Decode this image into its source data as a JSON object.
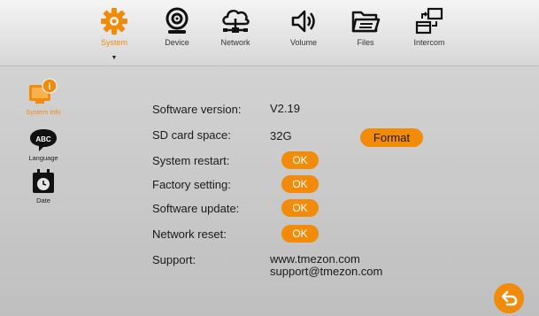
{
  "tabs": [
    {
      "label": "System",
      "icon": "gear-icon",
      "active": true
    },
    {
      "label": "Device",
      "icon": "webcam-icon"
    },
    {
      "label": "Network",
      "icon": "cloud-network-icon"
    },
    {
      "label": "Volume",
      "icon": "speaker-icon"
    },
    {
      "label": "Files",
      "icon": "folder-icon"
    },
    {
      "label": "Intercom",
      "icon": "intercom-icon"
    }
  ],
  "active_tab_marker": "▼",
  "sidebar": [
    {
      "label": "System info",
      "icon": "system-info-icon",
      "active": true,
      "badge": "i"
    },
    {
      "label": "Language",
      "icon": "language-bubble-icon",
      "badge": "ABC"
    },
    {
      "label": "Date",
      "icon": "calendar-clock-icon"
    }
  ],
  "settings": {
    "software_version": {
      "label": "Software version:",
      "value": "V2.19"
    },
    "sd_card": {
      "label": "SD card space:",
      "value": "32G",
      "button": "Format"
    },
    "system_restart": {
      "label": "System restart:",
      "button": "OK"
    },
    "factory_setting": {
      "label": "Factory setting:",
      "button": "OK"
    },
    "software_update": {
      "label": "Software update:",
      "button": "OK"
    },
    "network_reset": {
      "label": "Network reset:",
      "button": "OK"
    },
    "support": {
      "label": "Support:",
      "website": "www.tmezon.com",
      "email": "support@tmezon.com"
    }
  },
  "colors": {
    "accent": "#f28a0a",
    "text": "#1a1a1a"
  },
  "back_icon": "back-arrow-icon"
}
